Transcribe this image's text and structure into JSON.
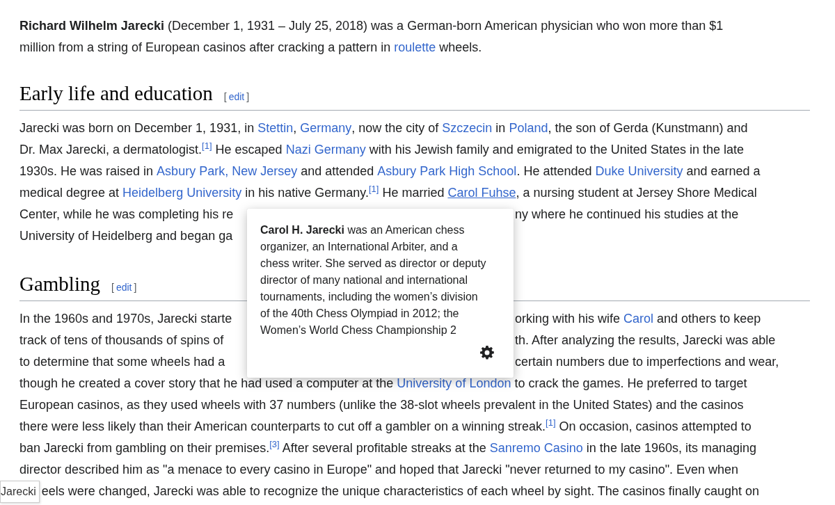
{
  "intro": {
    "lines": [
      {
        "segments": [
          {
            "kind": "text",
            "text": "**Richard Wilhelm Jarecki** (December 1, 1931 – July 25, 2018) was a German-born American physician who won more than $1"
          }
        ]
      },
      {
        "segments": [
          {
            "kind": "text",
            "text": "million from a string of European casinos after cracking a pattern in "
          },
          {
            "kind": "link",
            "text": "roulette",
            "hovered": false
          },
          {
            "kind": "text",
            "text": " wheels."
          }
        ]
      }
    ]
  },
  "sections": [
    {
      "heading": "Early life and education",
      "edit_link": {
        "open": "[",
        "label": "edit",
        "close": "]"
      },
      "lines": [
        {
          "segments": [
            {
              "kind": "text",
              "text": "Jarecki was born on December 1, 1931, in "
            },
            {
              "kind": "link",
              "text": "Stettin",
              "hovered": false
            },
            {
              "kind": "text",
              "text": ", "
            },
            {
              "kind": "link",
              "text": "Germany",
              "hovered": false
            },
            {
              "kind": "text",
              "text": ", now the city of "
            },
            {
              "kind": "link",
              "text": "Szczecin",
              "hovered": false
            },
            {
              "kind": "text",
              "text": " in "
            },
            {
              "kind": "link",
              "text": "Poland",
              "hovered": false
            },
            {
              "kind": "text",
              "text": ", the son of Gerda (Kunstmann) and"
            }
          ]
        },
        {
          "segments": [
            {
              "kind": "text",
              "text": "Dr. Max Jarecki, a dermatologist."
            },
            {
              "kind": "ref",
              "text": "[1]"
            },
            {
              "kind": "text",
              "text": " He escaped "
            },
            {
              "kind": "link",
              "text": "Nazi Germany",
              "hovered": false
            },
            {
              "kind": "text",
              "text": " with his Jewish family and emigrated to the United States in the late"
            }
          ]
        },
        {
          "segments": [
            {
              "kind": "text",
              "text": "1930s. He was raised in "
            },
            {
              "kind": "link",
              "text": "Asbury Park, New Jersey",
              "hovered": false
            },
            {
              "kind": "text",
              "text": " and attended "
            },
            {
              "kind": "link",
              "text": "Asbury Park High School",
              "hovered": false
            },
            {
              "kind": "text",
              "text": ". He attended "
            },
            {
              "kind": "link",
              "text": "Duke University",
              "hovered": false
            },
            {
              "kind": "text",
              "text": " and earned a"
            }
          ]
        },
        {
          "segments": [
            {
              "kind": "text",
              "text": "medical degree at "
            },
            {
              "kind": "link",
              "text": "Heidelberg University",
              "hovered": false
            },
            {
              "kind": "text",
              "text": " in his native Germany."
            },
            {
              "kind": "ref",
              "text": "[1]"
            },
            {
              "kind": "text",
              "text": " He married "
            },
            {
              "kind": "link",
              "text": "Carol Fuhse",
              "hovered": true
            },
            {
              "kind": "text",
              "text": ", a nursing student at Jersey Shore Medical"
            }
          ]
        },
        {
          "left": [
            {
              "kind": "text",
              "text": "Center, while he was completing his re"
            }
          ],
          "right": [
            {
              "kind": "text",
              "text": "ny where he continued his studies at the"
            }
          ]
        },
        {
          "left": [
            {
              "kind": "text",
              "text": "University of Heidelberg and began ga"
            }
          ]
        }
      ]
    },
    {
      "heading": "Gambling",
      "edit_link": {
        "open": "[",
        "label": "edit",
        "close": "]"
      },
      "lines": [
        {
          "left": [
            {
              "kind": "text",
              "text": "In the 1960s and 1970s, Jarecki starte"
            }
          ],
          "right": [
            {
              "kind": "text",
              "text": "orking with his wife "
            },
            {
              "kind": "link",
              "text": "Carol",
              "hovered": false
            },
            {
              "kind": "text",
              "text": " and others to keep"
            }
          ]
        },
        {
          "left": [
            {
              "kind": "text",
              "text": "track of tens of thousands of spins of"
            }
          ],
          "right": [
            {
              "kind": "text",
              "text": "th. After analyzing the results, Jarecki was able"
            }
          ]
        },
        {
          "left": [
            {
              "kind": "text",
              "text": "to determine that some wheels had a"
            }
          ],
          "right": [
            {
              "kind": "text",
              "text": "certain numbers due to imperfections and wear,"
            }
          ]
        },
        {
          "segments": [
            {
              "kind": "text",
              "text": "though he created a cover story that he had used a computer at the "
            },
            {
              "kind": "link",
              "text": "University of London",
              "hovered": false
            },
            {
              "kind": "text",
              "text": " to crack the games. He preferred to target"
            }
          ]
        },
        {
          "segments": [
            {
              "kind": "text",
              "text": "European casinos, as they used wheels with 37 numbers (unlike the 38-slot wheels prevalent in the United States) and the casinos"
            }
          ]
        },
        {
          "segments": [
            {
              "kind": "text",
              "text": "there were less likely than their American counterparts to cut off a gambler on a winning streak."
            },
            {
              "kind": "ref",
              "text": "[1]"
            },
            {
              "kind": "text",
              "text": " On occasion, casinos attempted to"
            }
          ]
        },
        {
          "segments": [
            {
              "kind": "text",
              "text": "ban Jarecki from gambling on their premises."
            },
            {
              "kind": "ref",
              "text": "[3]"
            },
            {
              "kind": "text",
              "text": " After several profitable streaks at the "
            },
            {
              "kind": "link",
              "text": "Sanremo Casino",
              "hovered": false
            },
            {
              "kind": "text",
              "text": " in the late 1960s, its managing"
            }
          ]
        },
        {
          "segments": [
            {
              "kind": "text",
              "text": "director described him as \"a menace to every casino in Europe\" and hoped that Jarecki \"never returned to my casino\". Even when"
            }
          ]
        },
        {
          "leading_tooltip": "Jarecki",
          "segments": [
            {
              "kind": "text",
              "text": "eels were changed, Jarecki was able to recognize the unique characteristics of each wheel by sight. The casinos finally caught on"
            }
          ]
        }
      ]
    }
  ],
  "preview_popup": {
    "lines": [
      "**Carol H. Jarecki** was an American chess",
      "organizer, an International Arbiter, and a",
      "chess writer. She served as director or deputy",
      "director of many national and international",
      "tournaments, including the women’s division",
      "of the 40th Chess Olympiad in 2012; the",
      "Women’s World Chess Championship 2"
    ]
  }
}
